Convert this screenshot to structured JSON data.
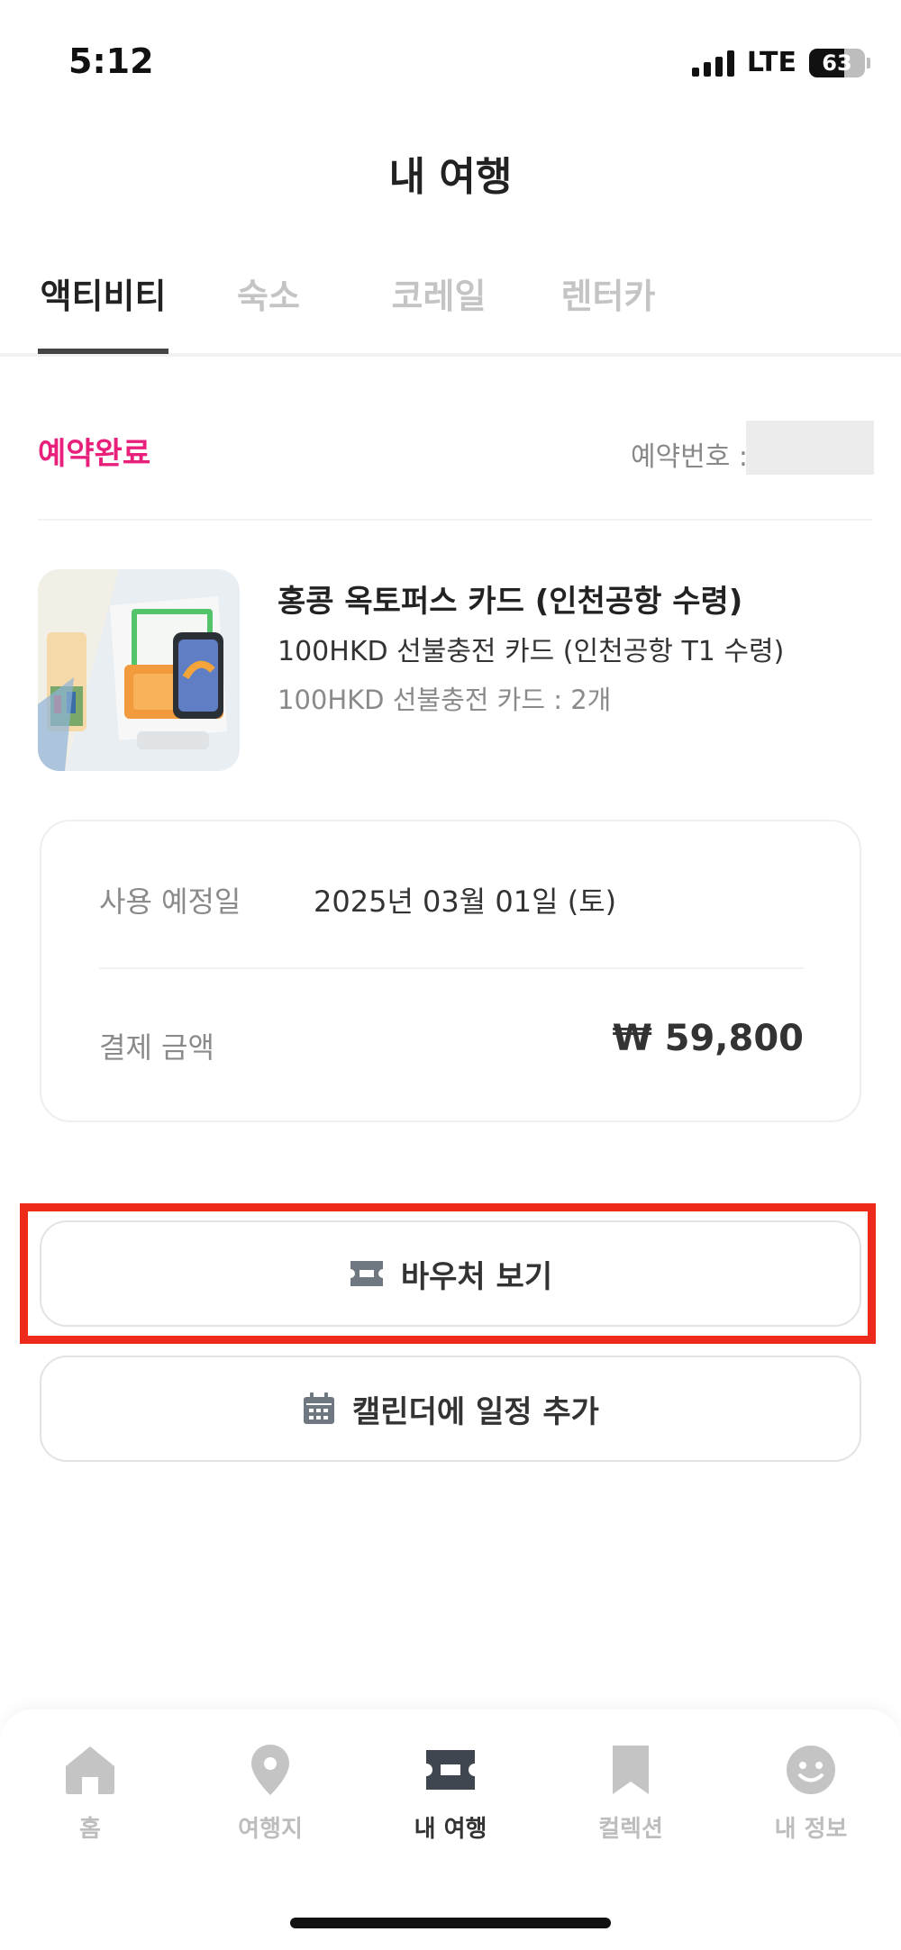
{
  "status_bar": {
    "time": "5:12",
    "network": "LTE",
    "battery": "63",
    "battery_level": 0.63
  },
  "header": {
    "title": "내 여행"
  },
  "tabs": [
    {
      "label": "액티비티",
      "active": true
    },
    {
      "label": "숙소",
      "active": false
    },
    {
      "label": "코레일",
      "active": false
    },
    {
      "label": "렌터카",
      "active": false
    }
  ],
  "reservation": {
    "status": "예약완료",
    "number_label": "예약번호 :",
    "product_title": "홍콩 옥토퍼스 카드 (인천공항 수령)",
    "product_subtitle": "100HKD 선불충전 카드 (인천공항 T1 수령)",
    "product_option": "100HKD 선불충전 카드 : 2개",
    "date_label": "사용 예정일",
    "date_value": "2025년 03월 01일 (토)",
    "payment_label": "결제 금액",
    "payment_value": "₩ 59,800"
  },
  "actions": {
    "voucher_label": "바우처 보기",
    "calendar_label": "캘린더에 일정 추가"
  },
  "bottom_nav": [
    {
      "label": "홈",
      "icon": "home-icon",
      "active": false
    },
    {
      "label": "여행지",
      "icon": "location-pin-icon",
      "active": false
    },
    {
      "label": "내 여행",
      "icon": "ticket-icon",
      "active": true
    },
    {
      "label": "컬렉션",
      "icon": "bookmark-icon",
      "active": false
    },
    {
      "label": "내 정보",
      "icon": "smiley-icon",
      "active": false
    }
  ],
  "colors": {
    "accent_pink": "#e8207c",
    "highlight_red": "#ee2a1a",
    "inactive_gray": "#bdbdbd",
    "text_dark": "#333333"
  }
}
